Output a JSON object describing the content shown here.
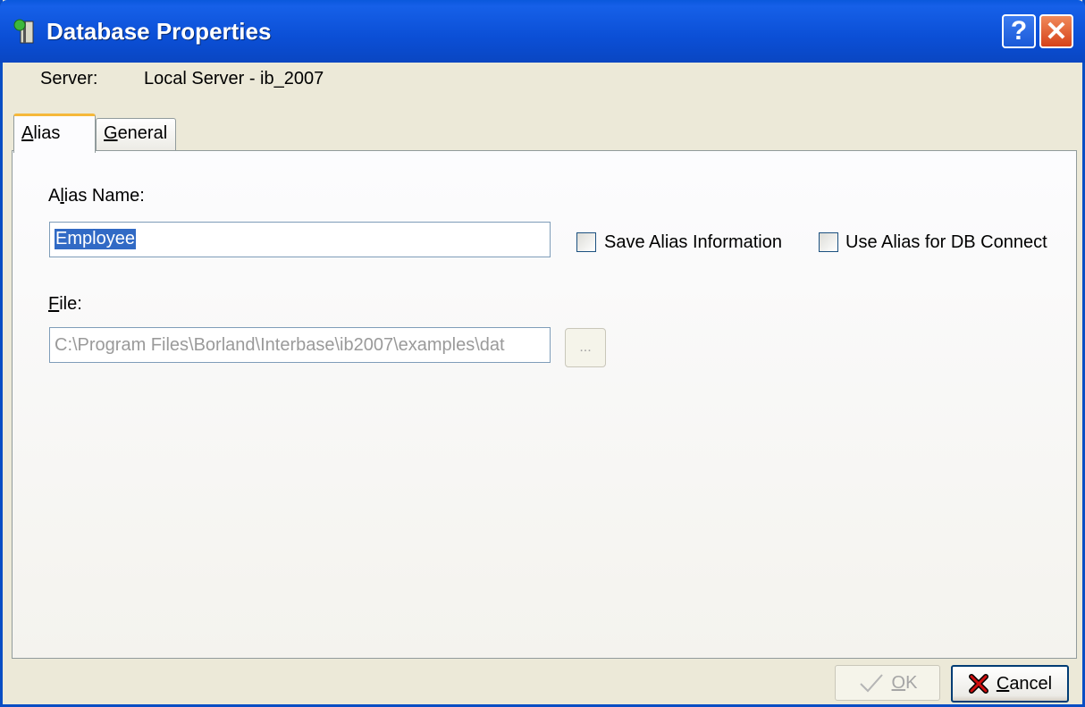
{
  "window": {
    "title": "Database Properties",
    "help_glyph": "?",
    "close_glyph": "✕"
  },
  "server": {
    "label": "Server:",
    "value": "Local Server - ib_2007"
  },
  "tabs": [
    {
      "label_underlined": "A",
      "label_rest": "lias"
    },
    {
      "label_underlined": "G",
      "label_rest": "eneral"
    }
  ],
  "alias": {
    "label_first": "A",
    "label_underlined": "l",
    "label_rest": "ias Name:",
    "value": "Employee",
    "save_alias_label": "Save Alias Information",
    "use_alias_label": "Use Alias for DB Connect"
  },
  "file": {
    "label_underlined": "F",
    "label_rest": "ile:",
    "value": "C:\\Program Files\\Borland\\Interbase\\ib2007\\examples\\dat",
    "browse_label": "..."
  },
  "buttons": {
    "ok_underlined": "O",
    "ok_rest": "K",
    "cancel_underlined": "C",
    "cancel_rest": "ancel"
  },
  "colors": {
    "titlebar": "#0a58dc",
    "selection": "#316ac5",
    "tab_accent": "#f5b83a"
  }
}
